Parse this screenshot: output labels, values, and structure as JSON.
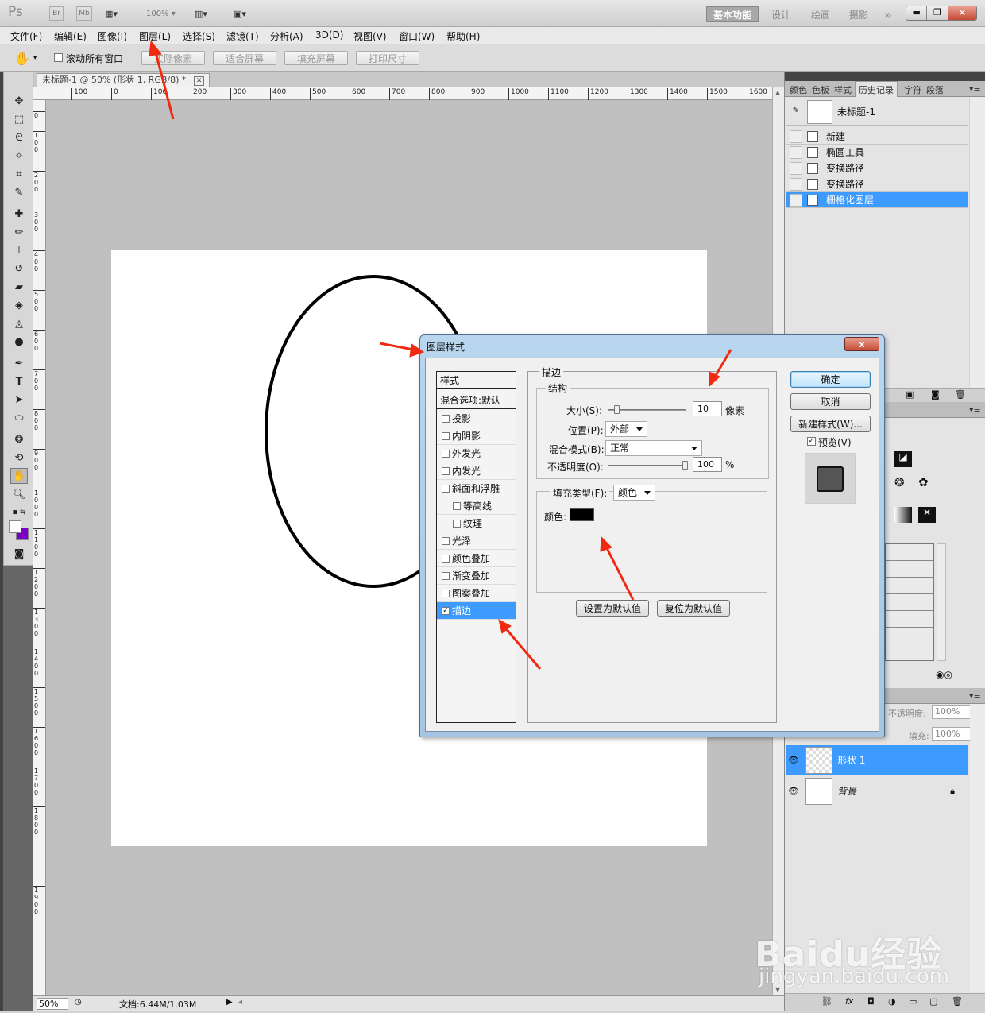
{
  "app": {
    "logo": "Ps",
    "bridge": "Br",
    "minibridge": "Mb",
    "zoom_top": "100%",
    "workspaces": [
      "基本功能",
      "设计",
      "绘画",
      "摄影"
    ],
    "more": "»"
  },
  "menubar": [
    "文件(F)",
    "编辑(E)",
    "图像(I)",
    "图层(L)",
    "选择(S)",
    "滤镜(T)",
    "分析(A)",
    "3D(D)",
    "视图(V)",
    "窗口(W)",
    "帮助(H)"
  ],
  "options": {
    "scroll_all": "滚动所有窗口",
    "buttons": [
      "实际像素",
      "适合屏幕",
      "填充屏幕",
      "打印尺寸"
    ]
  },
  "document": {
    "tab_title": "未标题-1 @ 50% (形状 1, RGB/8) *",
    "zoom": "50%",
    "doc_info": "文档:6.44M/1.03M"
  },
  "ruler": {
    "h": [
      "100",
      "0",
      "100",
      "200",
      "300",
      "400",
      "500",
      "600",
      "700",
      "800",
      "900",
      "1000",
      "1100",
      "1200",
      "1300",
      "1400",
      "1500",
      "1600"
    ],
    "v": [
      "0",
      "1\n0\n0",
      "2\n0\n0",
      "3\n0\n0",
      "4\n0\n0",
      "5\n0\n0",
      "6\n0\n0",
      "7\n0\n0",
      "8\n0\n0",
      "9\n0\n0",
      "1\n0\n0\n0",
      "1\n1\n0\n0",
      "1\n2\n0\n0",
      "1\n3\n0\n0",
      "1\n4\n0\n0",
      "1\n5\n0\n0",
      "1\n6\n0\n0",
      "1\n7\n0\n0",
      "1\n8\n0\n0",
      "1\n9\n0\n0"
    ]
  },
  "history_panel": {
    "tabs": [
      "颜色",
      "色板",
      "样式",
      "历史记录",
      "字符",
      "段落"
    ],
    "snapshot": "未标题-1",
    "items": [
      "新建",
      "椭圆工具",
      "变换路径",
      "变换路径",
      "栅格化图层"
    ],
    "selected_index": 4
  },
  "layers_panel": {
    "opacity_label": "不透明度:",
    "opacity_value": "100%",
    "fill_label": "填充:",
    "fill_value": "100%",
    "layers": [
      {
        "name": "形状 1",
        "selected": true
      },
      {
        "name": "背景",
        "selected": false,
        "locked": true
      }
    ]
  },
  "dialog": {
    "title": "图层样式",
    "close": "x",
    "style_list": [
      {
        "label": "样式",
        "type": "header"
      },
      {
        "label": "混合选项:默认",
        "type": "header"
      },
      {
        "label": "投影",
        "checked": false
      },
      {
        "label": "内阴影",
        "checked": false
      },
      {
        "label": "外发光",
        "checked": false
      },
      {
        "label": "内发光",
        "checked": false
      },
      {
        "label": "斜面和浮雕",
        "checked": false
      },
      {
        "label": "等高线",
        "checked": false,
        "indent": true
      },
      {
        "label": "纹理",
        "checked": false,
        "indent": true
      },
      {
        "label": "光泽",
        "checked": false
      },
      {
        "label": "颜色叠加",
        "checked": false
      },
      {
        "label": "渐变叠加",
        "checked": false
      },
      {
        "label": "图案叠加",
        "checked": false
      },
      {
        "label": "描边",
        "checked": true,
        "selected": true
      }
    ],
    "stroke": {
      "section": "描边",
      "structure": "结构",
      "size_label": "大小(S):",
      "size_value": "10",
      "size_unit": "像素",
      "position_label": "位置(P):",
      "position_value": "外部",
      "blend_label": "混合模式(B):",
      "blend_value": "正常",
      "opacity_label": "不透明度(O):",
      "opacity_value": "100",
      "opacity_unit": "%",
      "fill_type_label": "填充类型(F):",
      "fill_type_value": "颜色",
      "color_label": "颜色:",
      "color_value": "#000000"
    },
    "buttons": {
      "ok": "确定",
      "cancel": "取消",
      "new_style": "新建样式(W)...",
      "preview": "预览(V)",
      "make_default": "设置为默认值",
      "reset_default": "复位为默认值"
    }
  },
  "watermark": {
    "line1": "Baidu经验",
    "line2": "jingyan.baidu.com"
  },
  "colors": {
    "accent": "#3d9bff",
    "annotation": "#f02a10",
    "foreground": "#7a00c8",
    "background": "#ffffff"
  }
}
